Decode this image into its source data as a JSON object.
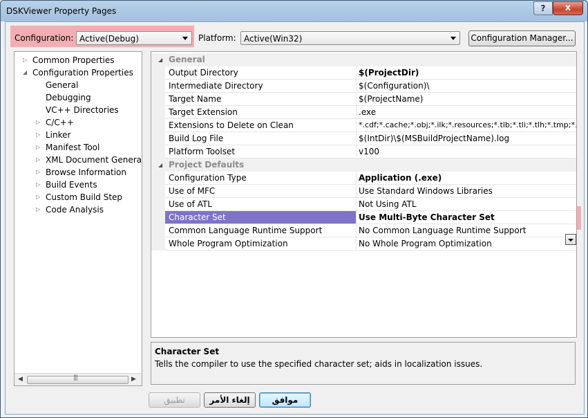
{
  "window": {
    "title": "DSKViewer Property Pages",
    "help_label": "?",
    "close_label": "x"
  },
  "toolbar": {
    "configuration_label": "Configuration:",
    "configuration_value": "Active(Debug)",
    "platform_label": "Platform:",
    "platform_value": "Active(Win32)",
    "config_manager_label": "Configuration Manager..."
  },
  "tree": {
    "items": [
      {
        "label": "Common Properties",
        "expander": "▷"
      },
      {
        "label": "Configuration Properties",
        "expander": "◢"
      },
      {
        "label": "General",
        "expander": ""
      },
      {
        "label": "Debugging",
        "expander": ""
      },
      {
        "label": "VC++ Directories",
        "expander": ""
      },
      {
        "label": "C/C++",
        "expander": "▷"
      },
      {
        "label": "Linker",
        "expander": "▷"
      },
      {
        "label": "Manifest Tool",
        "expander": "▷"
      },
      {
        "label": "XML Document Generator",
        "expander": "▷"
      },
      {
        "label": "Browse Information",
        "expander": "▷"
      },
      {
        "label": "Build Events",
        "expander": "▷"
      },
      {
        "label": "Custom Build Step",
        "expander": "▷"
      },
      {
        "label": "Code Analysis",
        "expander": "▷"
      }
    ],
    "scroll_left": "◀",
    "scroll_right": "▶",
    "scroll_grip": "|||"
  },
  "grid": {
    "categories": [
      {
        "label": "General",
        "toggle": "◢"
      },
      {
        "label": "Project Defaults",
        "toggle": "◢"
      }
    ],
    "general_rows": [
      {
        "name": "Output Directory",
        "value": "$(ProjectDir)"
      },
      {
        "name": "Intermediate Directory",
        "value": "$(Configuration)\\"
      },
      {
        "name": "Target Name",
        "value": "$(ProjectName)"
      },
      {
        "name": "Target Extension",
        "value": ".exe"
      },
      {
        "name": "Extensions to Delete on Clean",
        "value": "*.cdf;*.cache;*.obj;*.ilk;*.resources;*.tlb;*.tli;*.tlh;*.tmp;*.rsp;*"
      },
      {
        "name": "Build Log File",
        "value": "$(IntDir)\\$(MSBuildProjectName).log"
      },
      {
        "name": "Platform Toolset",
        "value": "v100"
      }
    ],
    "defaults_rows": [
      {
        "name": "Configuration Type",
        "value": "Application (.exe)"
      },
      {
        "name": "Use of MFC",
        "value": "Use Standard Windows Libraries"
      },
      {
        "name": "Use of ATL",
        "value": "Not Using ATL"
      },
      {
        "name": "Character Set",
        "value": "Use Multi-Byte Character Set"
      },
      {
        "name": "Common Language Runtime Support",
        "value": "No Common Language Runtime Support"
      },
      {
        "name": "Whole Program Optimization",
        "value": "No Whole Program Optimization"
      }
    ]
  },
  "description": {
    "title": "Character Set",
    "text": "Tells the compiler to use the specified character set; aids in localization issues."
  },
  "buttons": {
    "ok": "موافق",
    "cancel": "إلغاء الأمر",
    "apply": "تطبيق"
  },
  "colors": {
    "highlight": "#f57882",
    "selected_row": "#7f73c7"
  }
}
